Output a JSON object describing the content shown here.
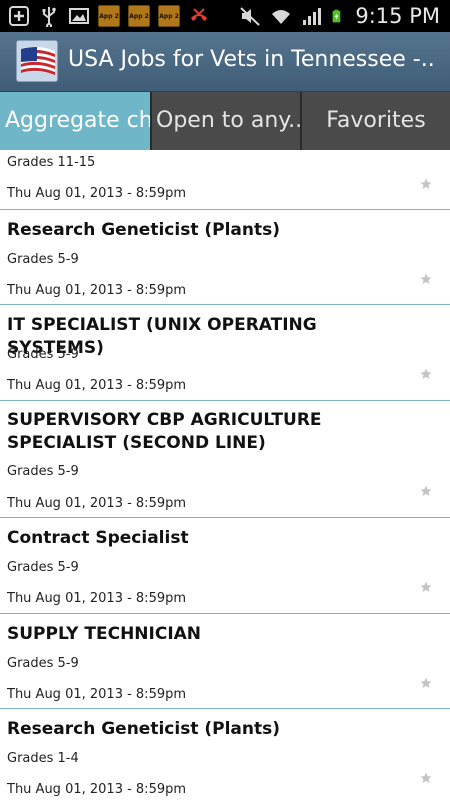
{
  "status_bar": {
    "time": "9:15 PM",
    "app_badge_text": "App 2",
    "left_icons": [
      "add-icon",
      "usb-icon",
      "image-icon",
      "app-notification-icon",
      "app-notification-icon",
      "app-notification-icon",
      "missed-call-icon"
    ],
    "right_icons": [
      "mute-icon",
      "wifi-icon",
      "signal-icon",
      "battery-charging-icon"
    ],
    "colors": {
      "background": "#000000",
      "missed_call": "#e23c2c",
      "battery": "#4fc21c"
    }
  },
  "action_bar": {
    "title": "USA Jobs for Vets in Tennessee -..",
    "icon": "us-flag-icon",
    "background": "#4a6882"
  },
  "tabs": [
    {
      "label": "Aggregate ch",
      "selected": true
    },
    {
      "label": "Open to any..",
      "selected": false
    },
    {
      "label": "Favorites",
      "selected": false
    }
  ],
  "colors": {
    "tab_selected": "#6fb6c9",
    "tab_unselected": "#4a4a4a",
    "divider": "#7fb4c4"
  },
  "jobs": [
    {
      "title": "",
      "grade": "Grades 11-15",
      "date": "Thu Aug 01, 2013 - 8:59pm"
    },
    {
      "title": "Research Geneticist (Plants)",
      "grade": "Grades 5-9",
      "date": "Thu Aug 01, 2013 - 8:59pm"
    },
    {
      "title": "IT SPECIALIST (UNIX OPERATING SYSTEMS)",
      "grade": "Grades 5-9",
      "date": "Thu Aug 01, 2013 - 8:59pm"
    },
    {
      "title": "SUPERVISORY CBP AGRICULTURE SPECIALIST (SECOND LINE)",
      "grade": "Grades 5-9",
      "date": "Thu Aug 01, 2013 - 8:59pm"
    },
    {
      "title": "Contract Specialist",
      "grade": "Grades 5-9",
      "date": "Thu Aug 01, 2013 - 8:59pm"
    },
    {
      "title": "SUPPLY TECHNICIAN",
      "grade": "Grades 5-9",
      "date": "Thu Aug 01, 2013 - 8:59pm"
    },
    {
      "title": "Research Geneticist (Plants)",
      "grade": "Grades 1-4",
      "date": "Thu Aug 01, 2013 - 8:59pm"
    }
  ]
}
